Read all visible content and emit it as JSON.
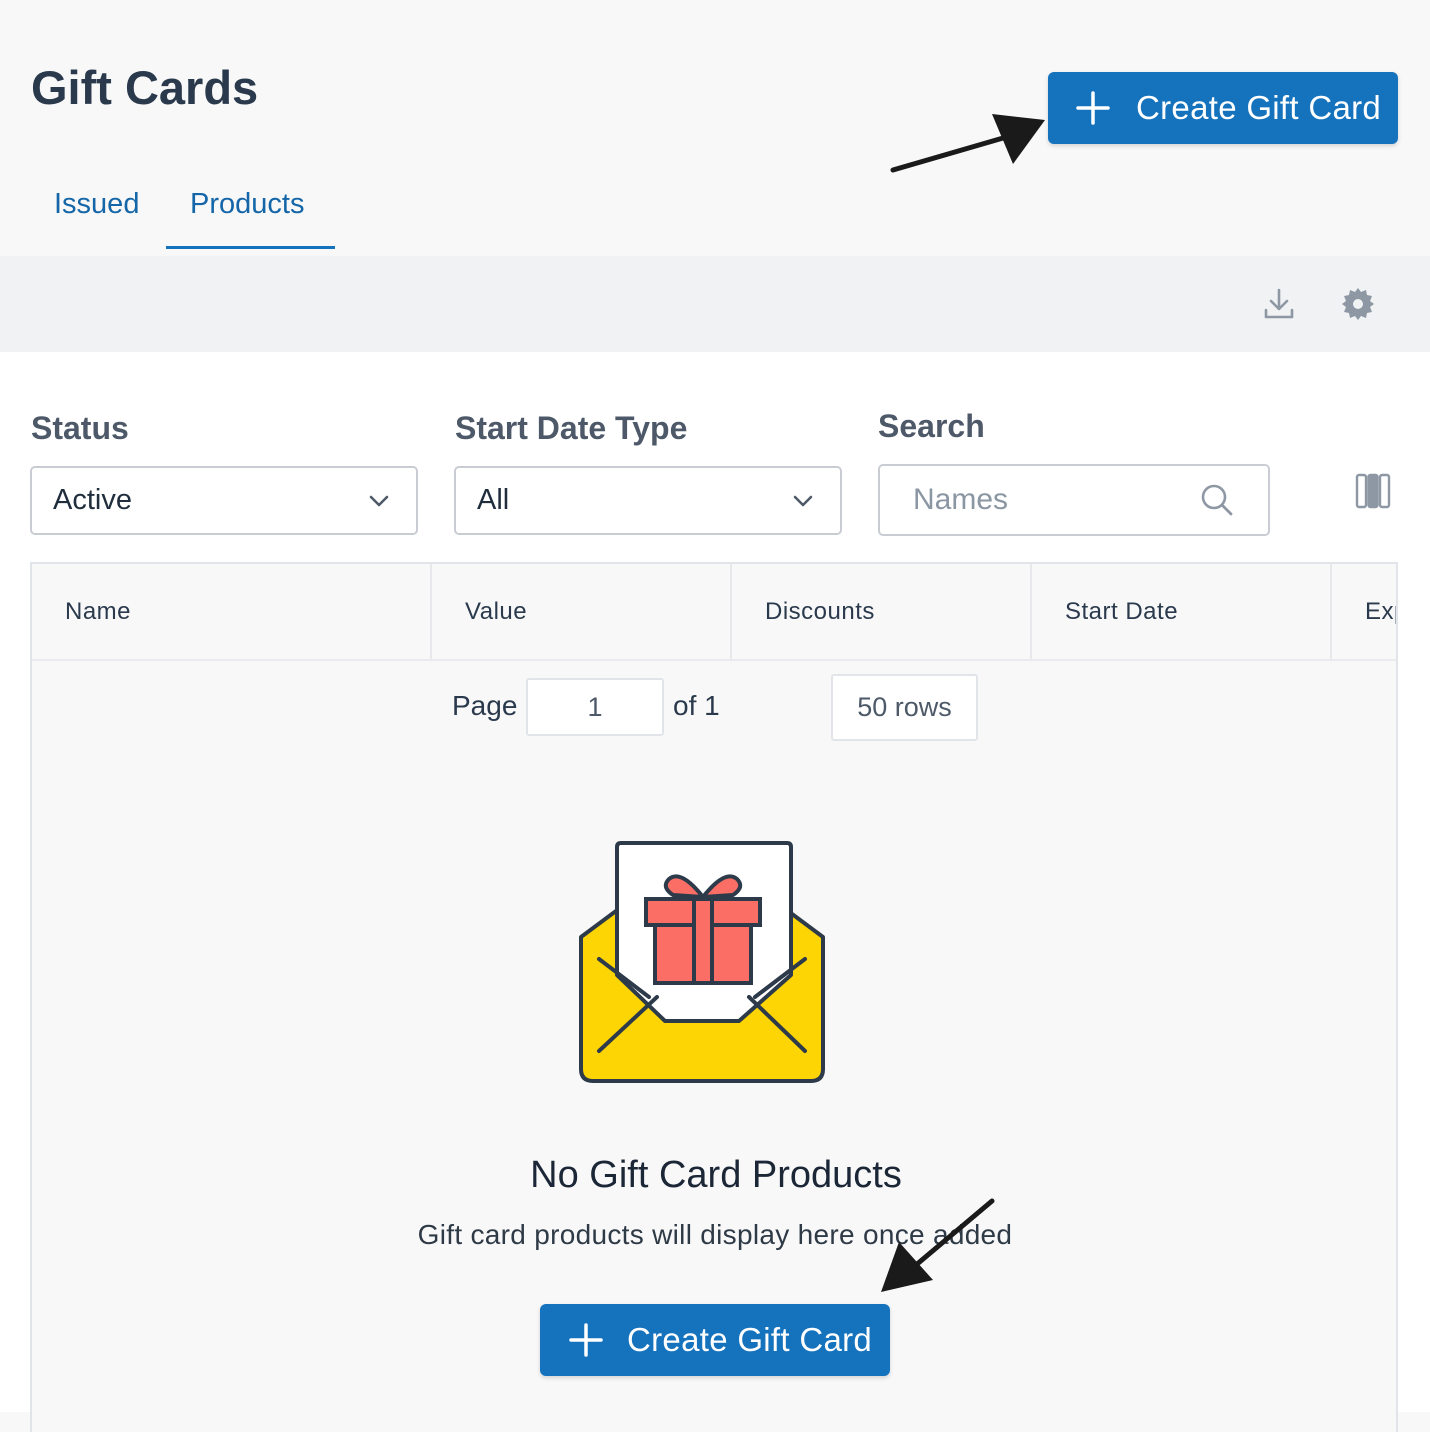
{
  "header": {
    "title": "Gift Cards",
    "create_button_label": "Create Gift Card"
  },
  "tabs": [
    {
      "label": "Issued",
      "active": false
    },
    {
      "label": "Products",
      "active": true
    }
  ],
  "toolbar": {
    "icons": [
      "download-icon",
      "gear-icon"
    ]
  },
  "filters": {
    "status": {
      "label": "Status",
      "value": "Active"
    },
    "start_date_type": {
      "label": "Start Date Type",
      "value": "All"
    },
    "search": {
      "label": "Search",
      "placeholder": "Names"
    }
  },
  "table": {
    "columns": [
      "Name",
      "Value",
      "Discounts",
      "Start Date",
      "Exp"
    ]
  },
  "pagination": {
    "page_label": "Page",
    "current_page": "1",
    "of_label": "of 1",
    "rows_label": "50 rows"
  },
  "empty_state": {
    "title": "No Gift Card Products",
    "subtitle": "Gift card products will display here once added",
    "button_label": "Create Gift Card",
    "illustration": "envelope-gift-icon"
  },
  "colors": {
    "primary": "#1572bd",
    "tab_active": "#1466a8",
    "envelope": "#fdd404",
    "gift": "#fa6e66"
  }
}
